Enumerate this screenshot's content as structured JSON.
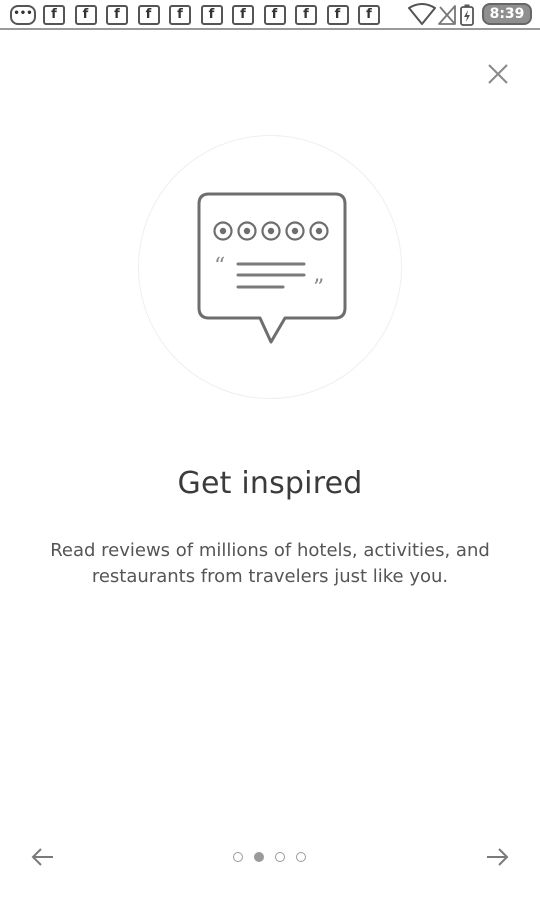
{
  "status_bar": {
    "more_icon": "more-notifications-icon",
    "notification_glyph": "f",
    "notification_icon": "facebook-icon",
    "notification_count": 11,
    "wifi_icon": "wifi-icon",
    "signal_icon": "no-signal-icon",
    "battery_icon": "battery-charging-icon",
    "time": "8:39"
  },
  "close": {
    "icon": "close-icon"
  },
  "illustration": {
    "icon": "review-speech-bubble-icon",
    "rating_circles": 5
  },
  "content": {
    "title": "Get inspired",
    "description": "Read reviews of millions of hotels, activities, and restaurants from travelers just like you."
  },
  "navigation": {
    "back_icon": "arrow-left-icon",
    "next_icon": "arrow-right-icon",
    "pages": 4,
    "current_page": 2
  },
  "colors": {
    "background": "#ffffff",
    "text": "#3b3b3b",
    "icon": "#6e6e6e",
    "circle_border": "#efefef"
  }
}
